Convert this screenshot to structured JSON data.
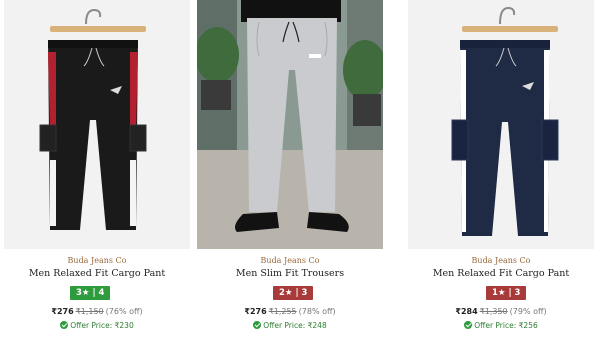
{
  "products": [
    {
      "brand": "Buda Jeans Co",
      "name": "Men Relaxed Fit Cargo Pant",
      "rating": "3★ | 4",
      "rating_color": "#2e9c3c",
      "price": "₹276",
      "mrp": "₹1,150",
      "discount": "(76% off)",
      "offer_price": "Offer Price: ₹230",
      "image_icon": "black-cargo-pant-image",
      "colors": {
        "pant": "#1a1a1a",
        "stripe": "#b3202f"
      }
    },
    {
      "brand": "Buda Jeans Co",
      "name": "Men Slim Fit Trousers",
      "rating": "2★ | 3",
      "rating_color": "#a83a3a",
      "price": "₹276",
      "mrp": "₹1,255",
      "discount": "(78% off)",
      "offer_price": "Offer Price: ₹248",
      "image_icon": "grey-trousers-model-image",
      "colors": {
        "pant": "#c9cbcf"
      }
    },
    {
      "brand": "Buda Jeans Co",
      "name": "Men Relaxed Fit Cargo Pant",
      "rating": "1★ | 3",
      "rating_color": "#a83a3a",
      "price": "₹284",
      "mrp": "₹1,350",
      "discount": "(79% off)",
      "offer_price": "Offer Price: ₹256",
      "image_icon": "navy-cargo-pant-image",
      "colors": {
        "pant": "#1f2a44",
        "stripe": "#ffffff"
      }
    }
  ],
  "offer_icon": "check-circle-icon"
}
